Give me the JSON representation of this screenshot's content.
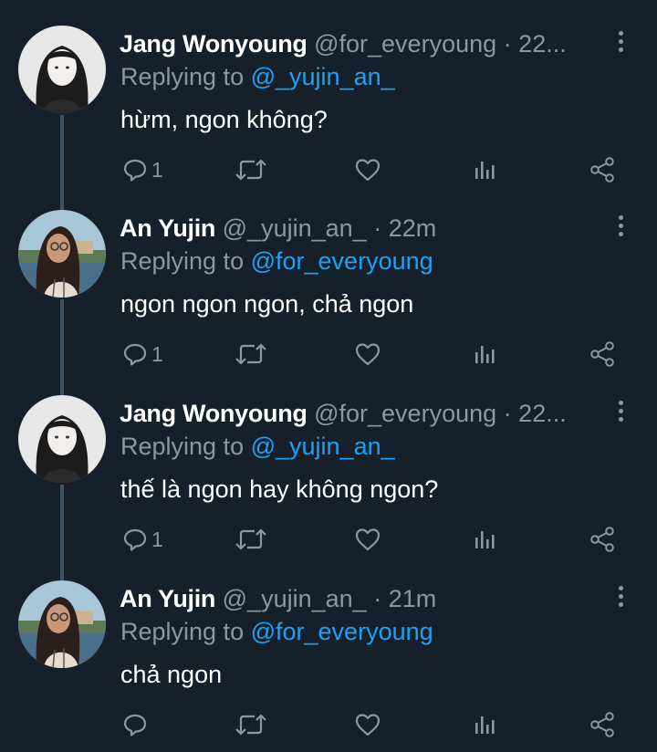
{
  "colors": {
    "background": "#15202b",
    "text": "#ffffff",
    "muted": "#8899a6",
    "accent": "#1da1f2",
    "thread_line": "#3d5466"
  },
  "reply_prefix": "Replying to",
  "tweets": [
    {
      "name": "Jang Wonyoung",
      "handle": "@for_everyoung",
      "sep": "·",
      "time": "22...",
      "reply_to": "@_yujin_an_",
      "text": "hừm, ngon không?",
      "reply_count": "1",
      "avatar": "grayscale-portrait"
    },
    {
      "name": "An Yujin",
      "handle": "@_yujin_an_",
      "sep": "·",
      "time": "22m",
      "reply_to": "@for_everyoung",
      "text": "ngon ngon ngon, chả ngon",
      "reply_count": "1",
      "avatar": "seaside-portrait"
    },
    {
      "name": "Jang Wonyoung",
      "handle": "@for_everyoung",
      "sep": "·",
      "time": "22...",
      "reply_to": "@_yujin_an_",
      "text": "thế là ngon hay không ngon?",
      "reply_count": "1",
      "avatar": "grayscale-portrait"
    },
    {
      "name": "An Yujin",
      "handle": "@_yujin_an_",
      "sep": "·",
      "time": "21m",
      "reply_to": "@for_everyoung",
      "text": "chả ngon",
      "reply_count": "",
      "avatar": "seaside-portrait"
    }
  ],
  "icons": {
    "reply": "reply-icon",
    "retweet": "retweet-icon",
    "like": "heart-icon",
    "analytics": "analytics-icon",
    "share": "share-icon",
    "more": "more-vertical-icon"
  }
}
